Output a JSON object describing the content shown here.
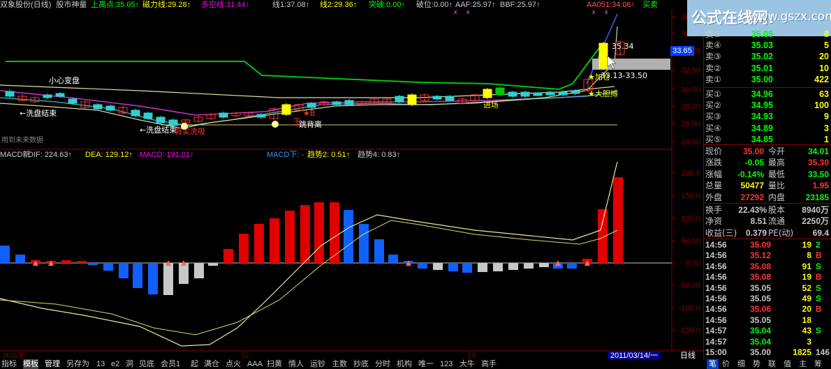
{
  "header": {
    "stock_name": "双象股份(日线)",
    "indicator_name": "股市神童",
    "items": [
      {
        "label": "上高点:",
        "value": "35.05",
        "color": "#00ff00"
      },
      {
        "label": "磁力线:",
        "value": "29.28",
        "color": "#ffff00"
      },
      {
        "label": "多空线:",
        "value": "31.44",
        "color": "#ff00ff"
      },
      {
        "label": "线1:",
        "value": "37.08",
        "color": "#c8c8c8"
      },
      {
        "label": "线2:",
        "value": "29.36",
        "color": "#ffff00"
      },
      {
        "label": "突破:",
        "value": "0.00",
        "color": "#00ff00"
      },
      {
        "label": "破位:",
        "value": "0.00",
        "color": "#c8c8c8"
      },
      {
        "label": "AAF:",
        "value": "25.97",
        "color": "#c8c8c8"
      },
      {
        "label": "BBF:",
        "value": "25.97",
        "color": "#c8c8c8"
      },
      {
        "label": "AA051:",
        "value": "34.06",
        "color": "#ff5555"
      },
      {
        "label": "",
        "value": "买卖",
        "color": "#00ff00"
      }
    ]
  },
  "main_chart": {
    "annotations": {
      "careful_change": "小心变盘",
      "wash_end_1": "←洗盘结束",
      "wash_end_2": "←洗盘结束",
      "false_wash": "假实洗吸",
      "star_b": "★B",
      "star_add": "★加仓",
      "big_gain": "★大胆搏",
      "enter": "进场",
      "deviation": "跳背离",
      "king": "王",
      "peak_label": "35.34",
      "range_label": "33.13-33.50",
      "future_data": "用到未来数据"
    },
    "price_axis": [
      "38.00",
      "36.00",
      "34.00",
      "32.00",
      "30.00",
      "28.00",
      "26.00",
      "24.00"
    ],
    "current_price_tag": "33.65"
  },
  "macd": {
    "title": "MACD新",
    "items": [
      {
        "label": "DIF:",
        "value": "224.63",
        "color": "#c8c8c8"
      },
      {
        "label": "DEA:",
        "value": "129.12",
        "color": "#ffff00"
      },
      {
        "label": "MACD:",
        "value": "191.01",
        "color": "#ff00ff"
      },
      {
        "label": "MACD下:",
        "value": "-",
        "color": "#3399ff"
      },
      {
        "label": "趋势2:",
        "value": "0.51",
        "color": "#ffff00"
      },
      {
        "label": "趋势4:",
        "value": "0.83",
        "color": "#c8c8c8"
      }
    ],
    "axis": [
      "200.0",
      "150.0",
      "100.0",
      "50.00",
      "0.00",
      "-50.00",
      "-100.0",
      "-150.0"
    ]
  },
  "time_axis": {
    "year": "2011年",
    "m2": "2",
    "m3": "3"
  },
  "date_box": "2011/03/14/一",
  "period": "日线",
  "watermark": {
    "cn": "公式在线网:",
    "url": "www.gszx.com.cn"
  },
  "orderbook": {
    "sell": [
      {
        "label": "卖⑤",
        "price": "35.05",
        "vol": "8"
      },
      {
        "label": "卖④",
        "price": "35.03",
        "vol": "5"
      },
      {
        "label": "卖③",
        "price": "35.02",
        "vol": "20"
      },
      {
        "label": "卖②",
        "price": "35.01",
        "vol": "10"
      },
      {
        "label": "卖①",
        "price": "35.00",
        "vol": "422"
      }
    ],
    "buy": [
      {
        "label": "买①",
        "price": "34.96",
        "vol": "63"
      },
      {
        "label": "买②",
        "price": "34.95",
        "vol": "100"
      },
      {
        "label": "买③",
        "price": "34.93",
        "vol": "9"
      },
      {
        "label": "买④",
        "price": "34.89",
        "vol": "3"
      },
      {
        "label": "买⑤",
        "price": "34.85",
        "vol": "1"
      }
    ]
  },
  "stats": [
    {
      "k1": "现价",
      "v1": "35.00",
      "c1": "#ff3333",
      "k2": "今开",
      "v2": "34.01",
      "c2": "#00ff00"
    },
    {
      "k1": "涨跌",
      "v1": "-0.05",
      "c1": "#00ff00",
      "k2": "最高",
      "v2": "35.30",
      "c2": "#ff3333"
    },
    {
      "k1": "涨幅",
      "v1": "-0.14%",
      "c1": "#00ff00",
      "k2": "最低",
      "v2": "33.50",
      "c2": "#00ff00"
    },
    {
      "k1": "总量",
      "v1": "50477",
      "c1": "#ffff00",
      "k2": "量比",
      "v2": "1.95",
      "c2": "#ff3333"
    },
    {
      "k1": "外盘",
      "v1": "27292",
      "c1": "#ff3333",
      "k2": "内盘",
      "v2": "23185",
      "c2": "#00ff00"
    }
  ],
  "stats2": [
    {
      "k1": "换手",
      "v1": "22.43%",
      "c1": "#c8c8c8",
      "k2": "股本",
      "v2": "8940万",
      "c2": "#c8c8c8"
    },
    {
      "k1": "净资",
      "v1": "8.51",
      "c1": "#c8c8c8",
      "k2": "流通",
      "v2": "2250万",
      "c2": "#c8c8c8"
    },
    {
      "k1": "收益(三)",
      "v1": "0.379",
      "c1": "#c8c8c8",
      "k2": "PE(动)",
      "v2": "69.4",
      "c2": "#c8c8c8"
    }
  ],
  "ticks": [
    {
      "time": "14:56",
      "price": "35.09",
      "pc": "#ff3333",
      "vol": "19",
      "flag": "2",
      "fc": "#00ff00"
    },
    {
      "time": "14:56",
      "price": "35.12",
      "pc": "#ff3333",
      "vol": "8",
      "flag": "B",
      "fc": "#ff3333"
    },
    {
      "time": "14:56",
      "price": "35.08",
      "pc": "#ff3333",
      "vol": "91",
      "flag": "S",
      "fc": "#00ff00"
    },
    {
      "time": "14:56",
      "price": "35.08",
      "pc": "#ff3333",
      "vol": "19",
      "flag": "B",
      "fc": "#ff3333"
    },
    {
      "time": "14:56",
      "price": "35.05",
      "pc": "#c8c8c8",
      "vol": "52",
      "flag": "S",
      "fc": "#00ff00"
    },
    {
      "time": "14:56",
      "price": "35.05",
      "pc": "#c8c8c8",
      "vol": "49",
      "flag": "S",
      "fc": "#00ff00"
    },
    {
      "time": "14:56",
      "price": "35.06",
      "pc": "#ff3333",
      "vol": "20",
      "flag": "B",
      "fc": "#ff3333"
    },
    {
      "time": "14:56",
      "price": "35.05",
      "pc": "#c8c8c8",
      "vol": "18",
      "flag": "",
      "fc": "#c8c8c8"
    },
    {
      "time": "14:57",
      "price": "35.04",
      "pc": "#00ff00",
      "vol": "43",
      "flag": "S",
      "fc": "#00ff00"
    },
    {
      "time": "14:57",
      "price": "35.04",
      "pc": "#00ff00",
      "vol": "3",
      "flag": "",
      "fc": "#c8c8c8"
    },
    {
      "time": "15:00",
      "price": "35.00",
      "pc": "#c8c8c8",
      "vol": "1825",
      "flag": "146",
      "fc": "#c8c8c8"
    }
  ],
  "bottom_tabs": [
    "指标",
    "模板",
    "管理",
    "另存为",
    "13",
    "e2",
    "洞",
    "见底",
    "会员1",
    "起",
    "满仓",
    "点火",
    "AAA",
    "扫黄",
    "情人",
    "运钞",
    "主数",
    "抄底",
    "分时",
    "机构",
    "唯一",
    "123",
    "大牛",
    "高手"
  ],
  "right_tabs": [
    "笔",
    "价",
    "细",
    "势",
    "联",
    "值",
    "主",
    "筹"
  ]
}
